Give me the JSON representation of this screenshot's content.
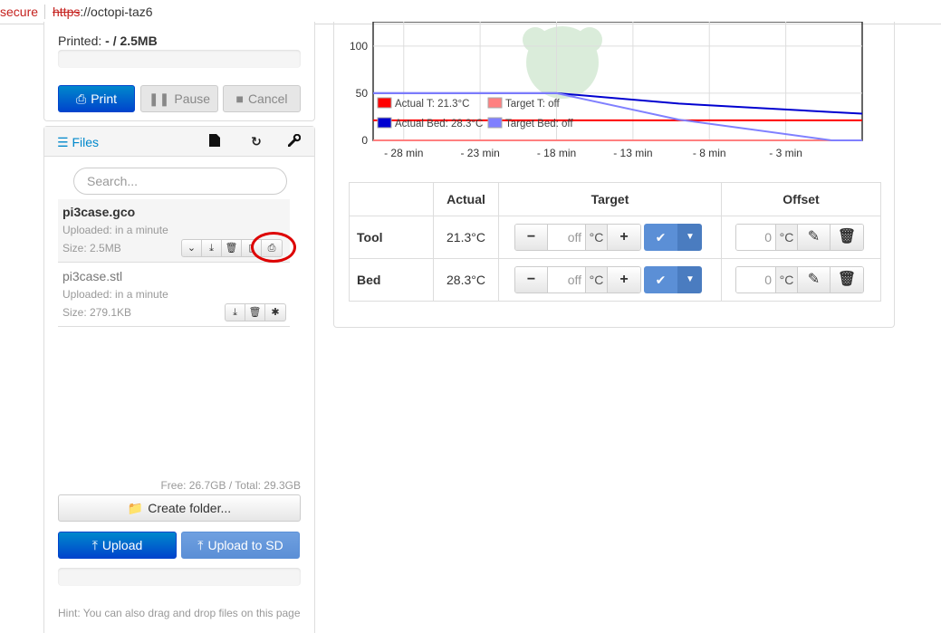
{
  "browser": {
    "security_text": "secure",
    "url_protocol": "https",
    "url_rest": "://octopi-taz6"
  },
  "state": {
    "printed_label": "Printed:",
    "printed_value": "- / 2.5MB",
    "print_label": "Print",
    "pause_label": "Pause",
    "cancel_label": "Cancel"
  },
  "files": {
    "title": "Files",
    "search_placeholder": "Search...",
    "items": [
      {
        "name": "pi3case.gco",
        "uploaded": "Uploaded: in a minute",
        "size": "Size: 2.5MB"
      },
      {
        "name": "pi3case.stl",
        "uploaded": "Uploaded: in a minute",
        "size": "Size: 279.1KB"
      }
    ],
    "free_text": "Free: 26.7GB / Total: 29.3GB",
    "create_folder_label": "Create folder...",
    "upload_label": "Upload",
    "upload_sd_label": "Upload to SD",
    "hint": "Hint: You can also drag and drop files on this page"
  },
  "chart_data": {
    "type": "line",
    "x_ticks": [
      "- 28 min",
      "- 23 min",
      "- 18 min",
      "- 13 min",
      "- 8 min",
      "- 3 min"
    ],
    "y_ticks": [
      "100",
      "50",
      "0"
    ],
    "ylim": [
      0,
      120
    ],
    "x_minutes": [
      -30,
      -20,
      -18,
      -10,
      0,
      2
    ],
    "series": [
      {
        "name": "Actual T: 21.3°C",
        "color": "#ff0000",
        "values": [
          21.3,
          21.3,
          21.3,
          21.3,
          21.3,
          21.3
        ]
      },
      {
        "name": "Target T: off",
        "color": "#ff8080",
        "values": [
          0,
          0,
          0,
          0,
          0,
          0
        ]
      },
      {
        "name": "Actual Bed: 28.3°C",
        "color": "#0000d0",
        "values": [
          50,
          50,
          50,
          39,
          30,
          28.3
        ]
      },
      {
        "name": "Target Bed: off",
        "color": "#8080ff",
        "values": [
          50,
          50,
          50,
          22,
          0,
          0
        ]
      }
    ]
  },
  "temps": {
    "headers": [
      "",
      "Actual",
      "Target",
      "Offset"
    ],
    "rows": [
      {
        "label": "Tool",
        "actual": "21.3°C",
        "target": "off",
        "offset": "0"
      },
      {
        "label": "Bed",
        "actual": "28.3°C",
        "target": "off",
        "offset": "0"
      }
    ],
    "unit": "°C"
  },
  "colors": {
    "primary": "#0055cc",
    "light_primary": "#5b8fd6",
    "highlight": "#dd0000"
  }
}
